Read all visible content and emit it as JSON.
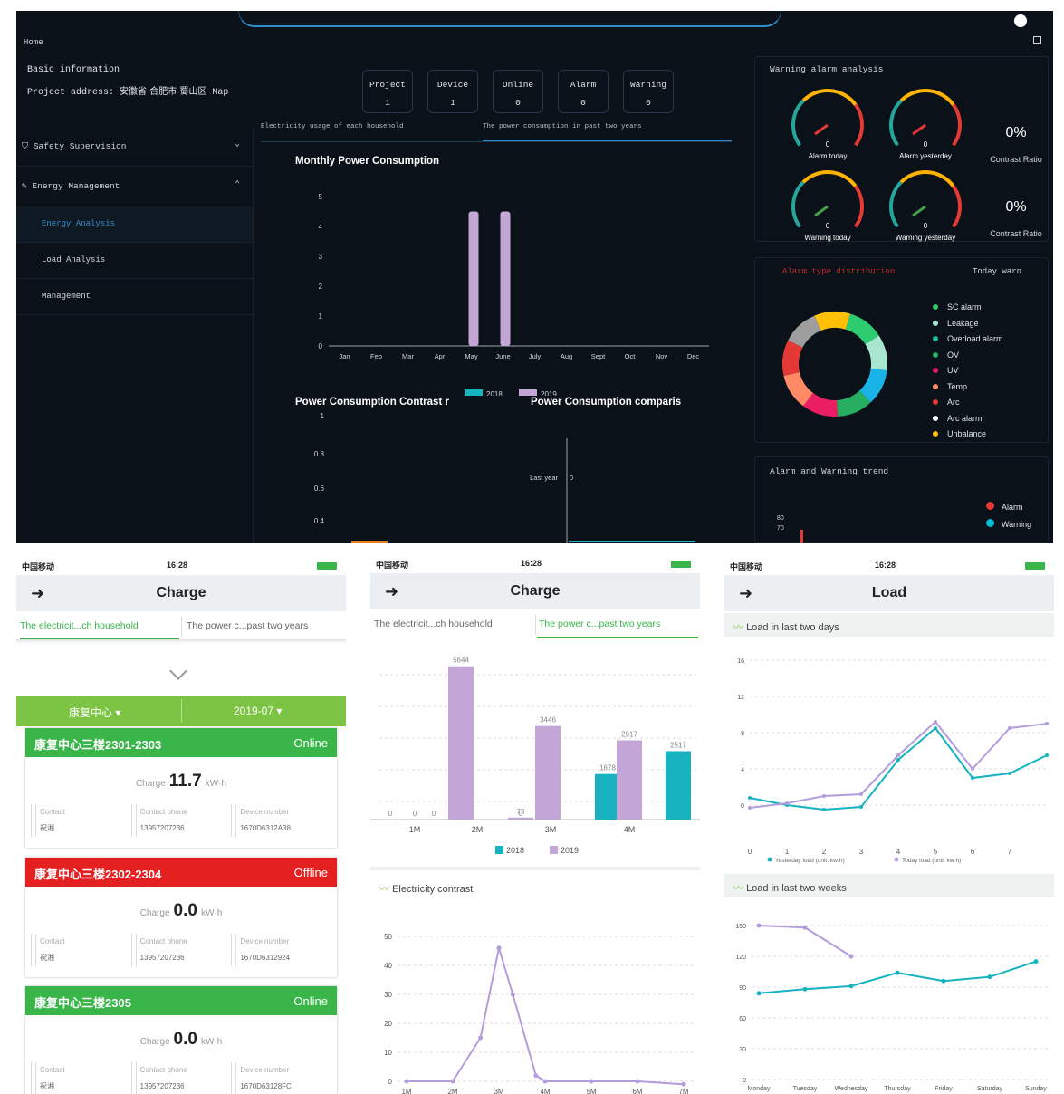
{
  "dashboard": {
    "home": "Home",
    "basic_info": {
      "title": "Basic information",
      "address_label": "Project address:",
      "address_value": "安徽省 合肥市 蜀山区",
      "map_label": "Map"
    },
    "stats": [
      {
        "label": "Project",
        "value": "1"
      },
      {
        "label": "Device",
        "value": "1"
      },
      {
        "label": "Online",
        "value": "0"
      },
      {
        "label": "Alarm",
        "value": "0"
      },
      {
        "label": "Warning",
        "value": "0"
      }
    ],
    "menu": [
      {
        "label": "Safety Supervision",
        "icon": "shield-icon",
        "arrow": "⌄"
      },
      {
        "label": "Energy Management",
        "icon": "leaf-icon",
        "arrow": "⌃"
      }
    ],
    "submenu": [
      "Energy Analysis",
      "Load Analysis",
      "Management"
    ],
    "chart_tabs": [
      "Electricity usage of each household",
      "The power consumption in past two years"
    ],
    "monthly": {
      "title": "Monthly Power Consumption",
      "legend": [
        "2018",
        "2019"
      ]
    },
    "bottom_titles": [
      "Power Consumption Contrast r",
      "Power Consumption comparis"
    ],
    "contrast_y_ticks": [
      "1",
      "0.8",
      "0.6",
      "0.4"
    ],
    "last_year_label": "Last year",
    "last_year_value": "0",
    "warning_panel": {
      "title": "Warning alarm analysis",
      "gauges": [
        {
          "label": "Alarm today",
          "value": "0",
          "color": "#e53935"
        },
        {
          "label": "Alarm yesterday",
          "value": "0",
          "color": "#e53935"
        },
        {
          "label": "Warning today",
          "value": "0",
          "color": "#43a047"
        },
        {
          "label": "Warning yesterday",
          "value": "0",
          "color": "#43a047"
        }
      ],
      "ratios": [
        {
          "value": "0%",
          "label": "Contrast Ratio"
        },
        {
          "value": "0%",
          "label": "Contrast Ratio"
        }
      ]
    },
    "alarm_types": {
      "title": "Alarm type distribution",
      "tab": "Today warn",
      "legend": [
        {
          "label": "SC alarm",
          "color": "#2ecc71"
        },
        {
          "label": "Leakage",
          "color": "#a8e6cf"
        },
        {
          "label": "Overload alarm",
          "color": "#1abc9c"
        },
        {
          "label": "OV",
          "color": "#27ae60"
        },
        {
          "label": "UV",
          "color": "#e91e63"
        },
        {
          "label": "Temp",
          "color": "#ff8a65"
        },
        {
          "label": "Arc",
          "color": "#e53935"
        },
        {
          "label": "Arc alarm",
          "color": "#ffffff"
        },
        {
          "label": "Unbalance",
          "color": "#ffc107"
        }
      ]
    },
    "trend": {
      "title": "Alarm and Warning trend",
      "y_ticks": [
        "80",
        "70"
      ],
      "legend": [
        {
          "label": "Alarm",
          "color": "#e53935"
        },
        {
          "label": "Warning",
          "color": "#00bcd4"
        }
      ]
    }
  },
  "phones": [
    {
      "status": {
        "carrier": "中国移动",
        "time": "16:28"
      },
      "title": "Charge",
      "tabs": [
        "The electricit...ch household",
        "The power c...past two years"
      ],
      "selectors": [
        "康复中心 ▾",
        "2019-07 ▾"
      ],
      "cards": [
        {
          "name": "康复中心三楼2301-2303",
          "status": "Online",
          "color": "#3ab54a",
          "charge_label": "Charge",
          "charge": "11.7",
          "unit": "kW·h",
          "contact_label": "Contact",
          "contact": "祝湘",
          "phone_label": "Contact phone",
          "phone": "13957207236",
          "device_label": "Device number",
          "device": "1670D6312A38"
        },
        {
          "name": "康复中心三楼2302-2304",
          "status": "Offline",
          "color": "#e52020",
          "charge_label": "Charge",
          "charge": "0.0",
          "unit": "kW·h",
          "contact_label": "Contact",
          "contact": "祝湘",
          "phone_label": "Contact phone",
          "phone": "13957207236",
          "device_label": "Device number",
          "device": "1670D6312924"
        },
        {
          "name": "康复中心三楼2305",
          "status": "Online",
          "color": "#3ab54a",
          "charge_label": "Charge",
          "charge": "0.0",
          "unit": "kW·h",
          "contact_label": "Contact",
          "contact": "祝湘",
          "phone_label": "Contact phone",
          "phone": "13957207236",
          "device_label": "Device number",
          "device": "1670D63128FC"
        }
      ]
    },
    {
      "status": {
        "carrier": "中国移动",
        "time": "16:28"
      },
      "title": "Charge",
      "tabs": [
        "The electricit...ch household",
        "The power c...past two years"
      ],
      "contrast_title": "Electricity contrast"
    },
    {
      "status": {
        "carrier": "中国移动",
        "time": "16:28"
      },
      "title": "Load",
      "section1": "Load in last two days",
      "section1_legend": [
        "Yesterday load (unit: kw·h)",
        "Today load (unit: kw·h)"
      ],
      "section2": "Load in last two weeks"
    }
  ],
  "chart_data": [
    {
      "type": "bar",
      "title": "Monthly Power Consumption",
      "categories": [
        "Jan",
        "Feb",
        "Mar",
        "Apr",
        "May",
        "June",
        "July",
        "Aug",
        "Sept",
        "Oct",
        "Nov",
        "Dec"
      ],
      "series": [
        {
          "name": "2018",
          "values": [
            0,
            0,
            0,
            0,
            0,
            0,
            0,
            0,
            0,
            0,
            0,
            0
          ],
          "color": "#17b3c1"
        },
        {
          "name": "2019",
          "values": [
            0,
            0,
            0,
            0,
            4.5,
            4.5,
            0,
            0,
            0,
            0,
            0,
            0
          ],
          "color": "#c4a6d6"
        }
      ],
      "yticks": [
        "0",
        "1",
        "2",
        "3",
        "4",
        "5"
      ],
      "ylim": [
        0,
        5
      ]
    },
    {
      "type": "bar",
      "categories": [
        "1M",
        "2M",
        "3M",
        "4M"
      ],
      "bar_x": [
        0.65,
        1.8,
        3.15,
        4.6
      ],
      "series": [
        {
          "name": "2018",
          "values": [
            0,
            0,
            0,
            1678,
            2517
          ],
          "color": "#17b3c1",
          "x": [
            0.2,
            1.0,
            2.6,
            4.2,
            5.5
          ]
        },
        {
          "name": "2019",
          "values": [
            0,
            5644,
            73,
            3446,
            2917
          ],
          "color": "#c4a6d6",
          "x": [
            0.65,
            1.5,
            2.6,
            3.1,
            4.6
          ]
        }
      ],
      "legend": [
        "2018",
        "2019"
      ],
      "ylim": [
        0,
        6000
      ]
    },
    {
      "type": "line",
      "title": "Electricity contrast",
      "x": [
        "1M",
        "2M",
        "3M",
        "4M",
        "5M",
        "6M",
        "7M"
      ],
      "y_ticks": [
        "0",
        "10",
        "20",
        "30",
        "40",
        "50"
      ],
      "ylim": [
        0,
        50
      ],
      "series": [
        {
          "name": "",
          "points": [
            [
              0,
              0
            ],
            [
              1,
              0
            ],
            [
              1.6,
              15
            ],
            [
              2,
              46
            ],
            [
              2.3,
              30
            ],
            [
              2.8,
              2
            ],
            [
              3,
              0
            ],
            [
              4,
              0
            ],
            [
              5,
              0
            ],
            [
              6,
              -1
            ]
          ],
          "color": "#b39ddb"
        }
      ]
    },
    {
      "type": "line",
      "title": "Load in last two days",
      "x": [
        "0",
        "1",
        "2",
        "3",
        "4",
        "5",
        "6",
        "7"
      ],
      "y_ticks": [
        "16",
        "12",
        "8",
        "4",
        "0"
      ],
      "ylim": [
        -4,
        16
      ],
      "series": [
        {
          "name": "Yesterday load (unit: kw·h)",
          "color": "#17b3c1",
          "values": [
            0.8,
            0,
            -0.5,
            -0.2,
            5,
            8.5,
            3,
            3.5,
            5.5
          ]
        },
        {
          "name": "Today load (unit: kw·h)",
          "color": "#b39ddb",
          "values": [
            -0.3,
            0.2,
            1,
            1.2,
            5.5,
            9.2,
            4,
            8.5,
            9
          ]
        }
      ]
    },
    {
      "type": "line",
      "title": "Load in last two weeks",
      "x": [
        "Monday",
        "Tuesday",
        "Wednesday",
        "Thursday",
        "Friday",
        "Saturday",
        "Sunday"
      ],
      "y_ticks": [
        "150",
        "120",
        "90",
        "60",
        "30",
        "0"
      ],
      "ylim": [
        0,
        150
      ],
      "series": [
        {
          "name": "",
          "color": "#b39ddb",
          "values": [
            150,
            148,
            120,
            null,
            null,
            null,
            null
          ]
        },
        {
          "name": "",
          "color": "#17b3c1",
          "values": [
            84,
            88,
            91,
            104,
            96,
            100,
            115
          ]
        }
      ]
    }
  ]
}
